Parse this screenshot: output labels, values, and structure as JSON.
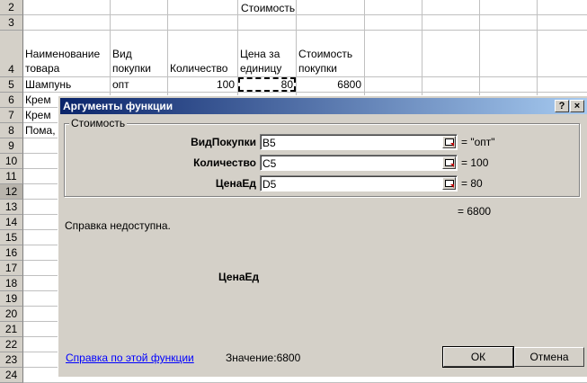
{
  "rows": [
    {
      "num": "2",
      "cells": {
        "d": "Стоимость"
      }
    },
    {
      "num": "3",
      "cells": {}
    },
    {
      "num": "4",
      "cells": {
        "a1": "Наименование",
        "a2": "товара",
        "b1": "Вид",
        "b2": "покупки",
        "c": "Количество",
        "d1": "Цена за",
        "d2": "единицу",
        "e1": "Стоимость",
        "e2": "покупки"
      }
    },
    {
      "num": "5",
      "cells": {
        "a": "Шампунь",
        "b": "опт",
        "c": "100",
        "d": "80",
        "e": "6800"
      }
    },
    {
      "num": "6",
      "cells": {
        "a": "Крем"
      }
    },
    {
      "num": "7",
      "cells": {
        "a": "Крем"
      }
    },
    {
      "num": "8",
      "cells": {
        "a": "Пома,"
      }
    },
    {
      "num": "9"
    },
    {
      "num": "10"
    },
    {
      "num": "11"
    },
    {
      "num": "12"
    },
    {
      "num": "13"
    },
    {
      "num": "14"
    },
    {
      "num": "15"
    },
    {
      "num": "16"
    },
    {
      "num": "17"
    },
    {
      "num": "18"
    },
    {
      "num": "19"
    },
    {
      "num": "20"
    },
    {
      "num": "21"
    },
    {
      "num": "22"
    },
    {
      "num": "23"
    },
    {
      "num": "24"
    }
  ],
  "dialog": {
    "title": "Аргументы функции",
    "help_btn": "?",
    "close_btn": "×",
    "group_label": "Стоимость",
    "args": [
      {
        "label": "ВидПокупки",
        "value": "B5",
        "result": "= \"опт\""
      },
      {
        "label": "Количество",
        "value": "C5",
        "result": "= 100"
      },
      {
        "label": "ЦенаЕд",
        "value": "D5",
        "result": "= 80"
      }
    ],
    "formula_result": "= 6800",
    "help_text": "Справка недоступна.",
    "current_arg": "ЦенаЕд",
    "help_link": "Справка по этой функции",
    "value_label": "Значение:",
    "value": "6800",
    "ok": "ОК",
    "cancel": "Отмена"
  }
}
